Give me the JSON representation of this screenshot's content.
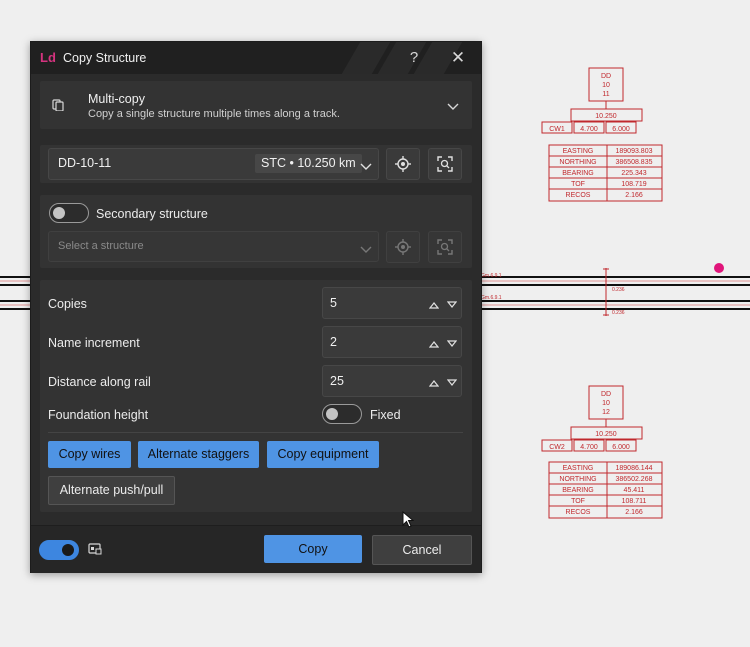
{
  "dialog": {
    "logo": "Ld",
    "title": "Copy Structure",
    "help_icon": "?",
    "close_icon": "✕"
  },
  "mode": {
    "title": "Multi-copy",
    "subtitle": "Copy a single structure multiple times along a track."
  },
  "structure": {
    "name": "DD-10-11",
    "badge": "STC • 10.250 km"
  },
  "secondary": {
    "label": "Secondary structure",
    "enabled": false,
    "placeholder": "Select a structure"
  },
  "params": {
    "copies_label": "Copies",
    "copies_value": "5",
    "name_increment_label": "Name increment",
    "name_increment_value": "2",
    "distance_label": "Distance along rail",
    "distance_value": "25",
    "foundation_label": "Foundation height",
    "foundation_toggle_label": "Fixed"
  },
  "buttons": {
    "copy_wires": "Copy wires",
    "alternate_staggers": "Alternate staggers",
    "copy_equipment": "Copy equipment",
    "alternate_push_pull": "Alternate push/pull"
  },
  "footer": {
    "copy": "Copy",
    "cancel": "Cancel"
  },
  "cad": {
    "top": {
      "id_lines": [
        "DD",
        "10",
        "11"
      ],
      "km": "10.250",
      "cw_name": "CW1",
      "cw_a": "4.700",
      "cw_b": "6.000",
      "rows": [
        {
          "label": "EASTING",
          "value": "189093.803"
        },
        {
          "label": "NORTHING",
          "value": "386508.835"
        },
        {
          "label": "BEARING",
          "value": "225.343"
        },
        {
          "label": "TOF",
          "value": "108.719"
        },
        {
          "label": "RECOS",
          "value": "2.166"
        }
      ]
    },
    "bottom": {
      "id_lines": [
        "DD",
        "10",
        "12"
      ],
      "km": "10.250",
      "cw_name": "CW2",
      "cw_a": "4.700",
      "cw_b": "6.000",
      "rows": [
        {
          "label": "EASTING",
          "value": "189086.144"
        },
        {
          "label": "NORTHING",
          "value": "386502.268"
        },
        {
          "label": "BEARING",
          "value": "45.411"
        },
        {
          "label": "TOF",
          "value": "108.711"
        },
        {
          "label": "RECOS",
          "value": "2.166"
        }
      ]
    },
    "track_label_1": "Gm.6.9.1",
    "track_label_2": "Gm.6.9.1",
    "stagger_1": "0.236",
    "stagger_2": "0.236",
    "line_color": "#c0282d",
    "marker_color": "#e0157a"
  },
  "colors": {
    "accent": "#4f94e4",
    "dialog_bg": "#2b2b2b",
    "brand": "#d5337f"
  }
}
